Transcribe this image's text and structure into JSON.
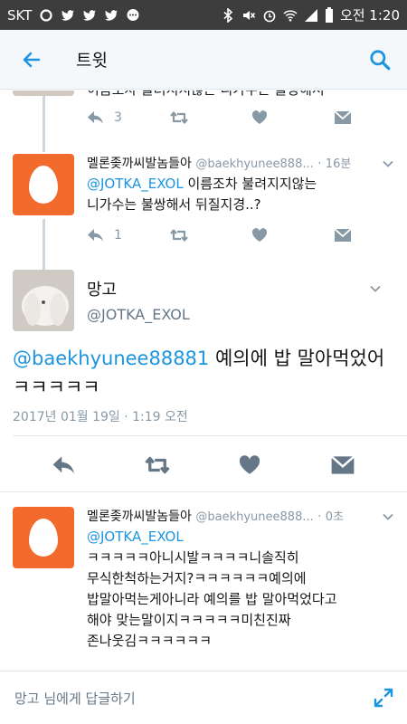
{
  "status_bar": {
    "carrier": "SKT",
    "time": "오전 1:20"
  },
  "app_bar": {
    "title": "트윗",
    "back_icon": "back-arrow-icon",
    "search_icon": "search-icon"
  },
  "prev_tweet": {
    "partial_text": "이름조차 불려지지않는 니가수는 불쌍해서",
    "reply_count": "3"
  },
  "reply_tweet_1": {
    "display_name": "멜론좆까씨발놈들아",
    "handle": "@baekhyunee888...",
    "sep": "·",
    "age": "16분",
    "mention": "@JOTKA_EXOL",
    "text": " 이름조차 불려지지않는",
    "text2": "니가수는 불쌍해서 뒤질지경..?",
    "reply_count": "1"
  },
  "focused_tweet": {
    "display_name": "망고",
    "handle": "@JOTKA_EXOL",
    "mention": "@baekhyunee88881",
    "text": " 예의에 밥 말아먹었어",
    "text2": "ㅋㅋㅋㅋㅋ",
    "timestamp": "2017년 01월 19일 · 1:19 오전"
  },
  "reply_tweet_2": {
    "display_name": "멜론좆까씨발놈들아",
    "handle": "@baekhyunee888...",
    "sep": "·",
    "age": "0초",
    "mention": "@JOTKA_EXOL",
    "lines": [
      "ㅋㅋㅋㅋㅋ아니시발ㅋㅋㅋㅋ니솔직히",
      "무식한척하는거지?ㅋㅋㅋㅋㅋㅋ예의에",
      "밥말아먹는게아니라 예의를 밥 말아먹었다고",
      "해야 맞는말이지ㅋㅋㅋㅋㅋ미친진짜",
      "존나웃김ㅋㅋㅋㅋㅋㅋ"
    ]
  },
  "reply_bar": {
    "placeholder": "망고 님에게 답글하기",
    "expand_icon": "expand-icon"
  },
  "colors": {
    "accent": "#1b95e0",
    "egg_avatar": "#f26a2c",
    "icon_gray": "#8899a6"
  }
}
